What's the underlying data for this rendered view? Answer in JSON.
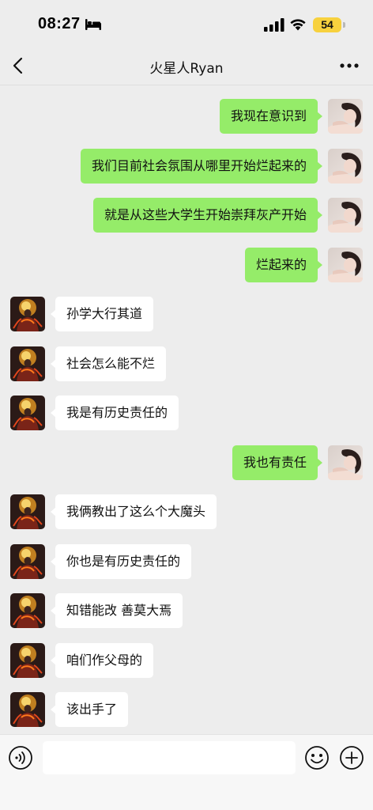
{
  "status_bar": {
    "time": "08:27",
    "battery": "54",
    "battery_color": "#f7d13e"
  },
  "nav": {
    "title": "火星人Ryan",
    "back_icon": "chevron-left-icon",
    "more_icon": "more-icon"
  },
  "messages": [
    {
      "sender": "me",
      "text": "我现在意识到"
    },
    {
      "sender": "me",
      "text": "我们目前社会氛围从哪里开始烂起来的"
    },
    {
      "sender": "me",
      "text": "就是从这些大学生开始崇拜灰产开始"
    },
    {
      "sender": "me",
      "text": "烂起来的"
    },
    {
      "sender": "other",
      "text": "孙学大行其道"
    },
    {
      "sender": "other",
      "text": "社会怎么能不烂"
    },
    {
      "sender": "other",
      "text": "我是有历史责任的"
    },
    {
      "sender": "me",
      "text": "我也有责任"
    },
    {
      "sender": "other",
      "text": "我俩教出了这么个大魔头"
    },
    {
      "sender": "other",
      "text": "你也是有历史责任的"
    },
    {
      "sender": "other",
      "text": "知错能改 善莫大焉"
    },
    {
      "sender": "other",
      "text": "咱们作父母的"
    },
    {
      "sender": "other",
      "text": "该出手了"
    }
  ],
  "input_bar": {
    "value": "",
    "placeholder": ""
  },
  "colors": {
    "my_bubble": "#95ec69",
    "other_bubble": "#ffffff",
    "background": "#ededed"
  }
}
